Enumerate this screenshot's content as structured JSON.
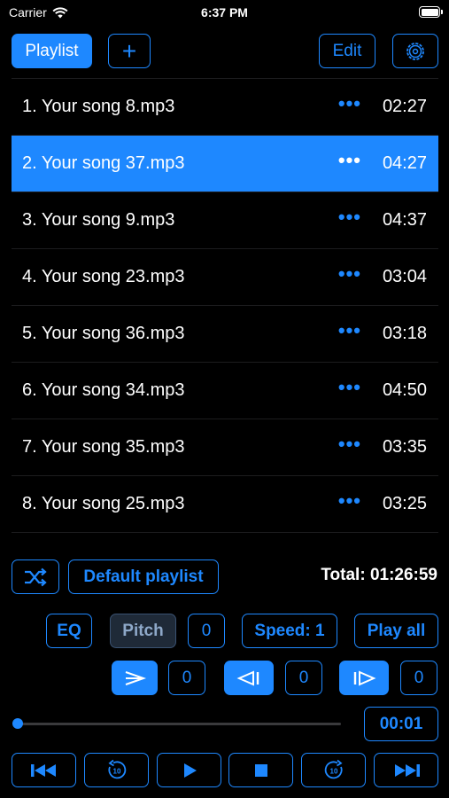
{
  "status": {
    "carrier": "Carrier",
    "time": "6:37 PM"
  },
  "toolbar": {
    "playlist_label": "Playlist",
    "add_label": "+",
    "edit_label": "Edit"
  },
  "songs": [
    {
      "title": "1. Your song 8.mp3",
      "duration": "02:27",
      "more": "•••",
      "selected": false
    },
    {
      "title": "2. Your song 37.mp3",
      "duration": "04:27",
      "more": "•••",
      "selected": true
    },
    {
      "title": "3. Your song 9.mp3",
      "duration": "04:37",
      "more": "•••",
      "selected": false
    },
    {
      "title": "4. Your song 23.mp3",
      "duration": "03:04",
      "more": "•••",
      "selected": false
    },
    {
      "title": "5. Your song 36.mp3",
      "duration": "03:18",
      "more": "•••",
      "selected": false
    },
    {
      "title": "6. Your song 34.mp3",
      "duration": "04:50",
      "more": "•••",
      "selected": false
    },
    {
      "title": "7. Your song 35.mp3",
      "duration": "03:35",
      "more": "•••",
      "selected": false
    },
    {
      "title": "8. Your song 25.mp3",
      "duration": "03:25",
      "more": "•••",
      "selected": false
    }
  ],
  "playlist_bar": {
    "playlist_name": "Default playlist",
    "total": "Total: 01:26:59"
  },
  "effects": {
    "eq_label": "EQ",
    "pitch_label": "Pitch",
    "pitch_value": "0",
    "speed_label": "Speed: 1",
    "play_all_label": "Play all"
  },
  "loop_controls": {
    "value_1": "0",
    "value_2": "0",
    "value_3": "0"
  },
  "progress": {
    "elapsed": "00:01",
    "fraction": 0.0
  },
  "icons": {
    "wifi": "wifi-icon",
    "battery": "battery-icon",
    "settings": "gear-icon",
    "shuffle": "shuffle-icon",
    "loop_a": "loop-a-icon",
    "loop_back": "loop-back-icon",
    "loop_forward": "loop-forward-icon",
    "prev": "skip-back-icon",
    "rewind": "rewind-10-icon",
    "play": "play-icon",
    "stop": "stop-icon",
    "forward": "forward-10-icon",
    "next": "skip-forward-icon"
  },
  "colors": {
    "accent": "#1e88ff",
    "background": "#000000",
    "selected_row": "#1e88ff"
  }
}
